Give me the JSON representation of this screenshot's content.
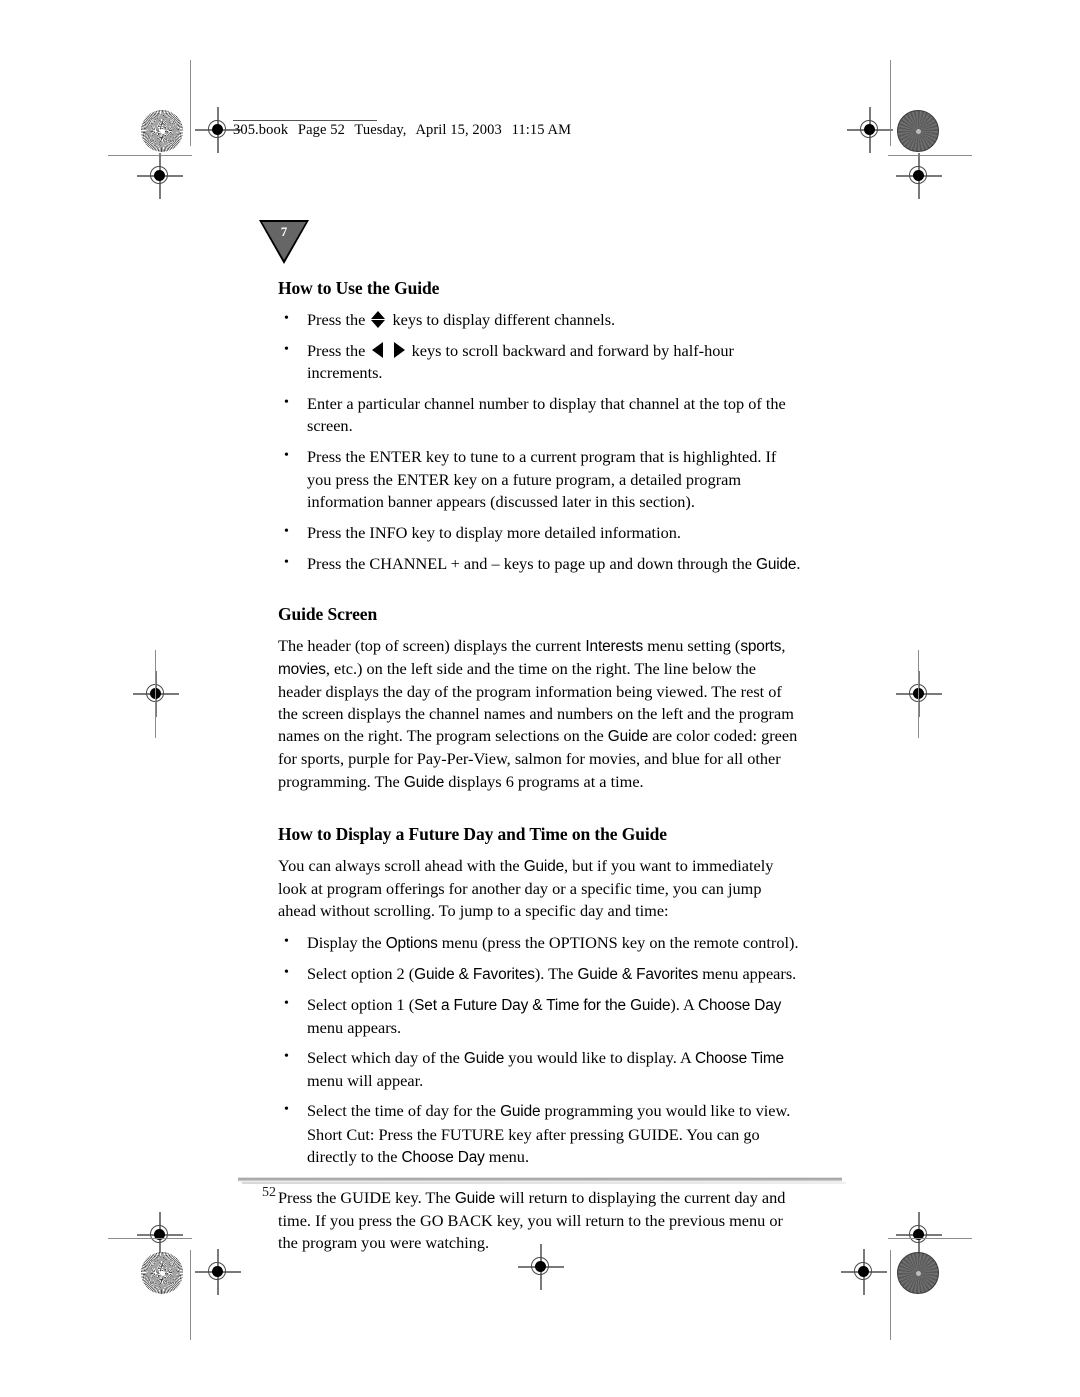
{
  "document": {
    "slug": {
      "file": "305.book",
      "page_label": "Page 52",
      "weekday": "Tuesday,",
      "date": "April 15, 2003",
      "time": "11:15 AM"
    },
    "chapter_marker": "7",
    "page_number": "52"
  },
  "sections": {
    "how_to_use": {
      "heading": "How to Use the Guide",
      "bullets": {
        "b1_pre": "Press the",
        "b1_post": "keys to display different channels.",
        "b2_pre": "Press the",
        "b2_post": "keys to scroll backward and forward by half-hour increments.",
        "b3": "Enter a particular channel number to display that channel at the top of the screen.",
        "b4": "Press the ENTER key to tune to a current program that is highlighted. If you press the ENTER key on a future program, a detailed program information banner appears (discussed later in this section).",
        "b5": "Press the INFO key to display more detailed information.",
        "b6_pre": "Press the CHANNEL + and – keys to page up and down through the",
        "b6_ui": "Guide",
        "b6_post": "."
      }
    },
    "guide_screen": {
      "heading": "Guide Screen",
      "p1_a": "The header (top of screen) displays the current",
      "p1_ui1": "Interests",
      "p1_b": "menu setting (",
      "p1_ui2": "sports",
      "p1_c": ",",
      "p1_ui3": "movies",
      "p1_d": ", etc.) on the left side and the time on the right. The line below the header displays the day of the program information being viewed. The rest of the screen displays the channel names and numbers on the left and the program names on the right. The program selections on the",
      "p1_ui4": "Guide",
      "p1_e": "are color coded: green for sports, purple for Pay-Per-View, salmon for movies, and blue for all other programming. The",
      "p1_ui5": "Guide",
      "p1_f": "displays 6 programs at a time."
    },
    "future_day": {
      "heading": "How to Display a Future Day and Time on the Guide",
      "p1_a": "You can always scroll ahead with the",
      "p1_ui1": "Guide",
      "p1_b": ", but if you want to immediately look at program offerings for another day or a specific time, you can jump ahead without scrolling. To jump to a specific day and time:",
      "bullets": {
        "b1_a": "Display the",
        "b1_ui": "Options",
        "b1_b": "menu (press the OPTIONS key on the remote control).",
        "b2_a": "Select option 2 (",
        "b2_ui1": "Guide & Favorites",
        "b2_b": "). The",
        "b2_ui2": "Guide & Favorites",
        "b2_c": "menu appears.",
        "b3_a": "Select option 1 (",
        "b3_ui1": "Set a Future Day & Time for the Guide",
        "b3_b": "). A",
        "b3_ui2": "Choose Day",
        "b3_c": "menu appears.",
        "b4_a": "Select which day of the",
        "b4_ui1": "Guide",
        "b4_b": "you would like to display. A",
        "b4_ui2": "Choose Time",
        "b4_c": "menu will appear.",
        "b5_a": "Select the time of day for the",
        "b5_ui1": "Guide",
        "b5_b": "programming you would like to view. Short Cut: Press the FUTURE key after pressing GUIDE. You can go directly to the",
        "b5_ui2": "Choose Day",
        "b5_c": "menu."
      },
      "closing_a": "Press the GUIDE key. The",
      "closing_ui": "Guide",
      "closing_b": "will return to displaying the current day and time. If you press the GO BACK key, you will return to the previous menu or the program you were watching."
    }
  },
  "colors": {
    "text": "#000000",
    "chapter_tab_fill": "#666666",
    "registration_mark": "#7a7a7a"
  }
}
